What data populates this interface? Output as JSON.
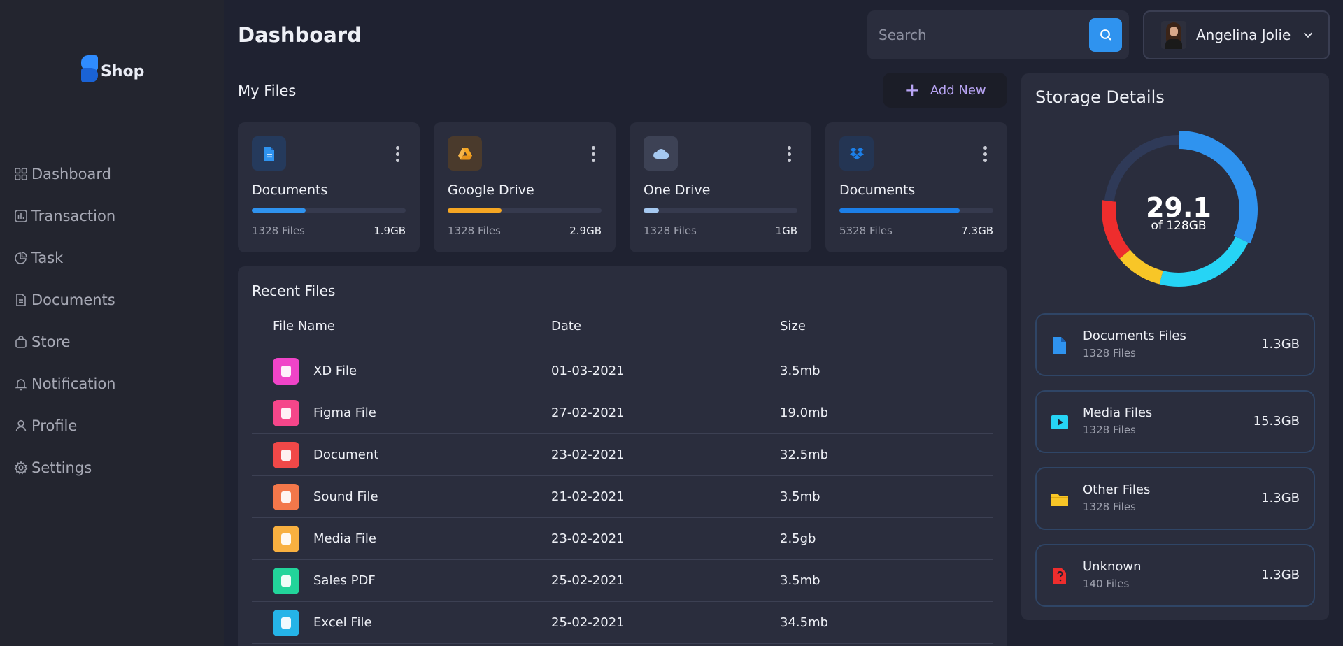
{
  "brand": {
    "name": "Shop"
  },
  "sidebar": {
    "items": [
      {
        "label": "Dashboard",
        "icon": "grid-icon"
      },
      {
        "label": "Transaction",
        "icon": "chart-icon"
      },
      {
        "label": "Task",
        "icon": "pie-icon"
      },
      {
        "label": "Documents",
        "icon": "document-icon"
      },
      {
        "label": "Store",
        "icon": "bag-icon"
      },
      {
        "label": "Notification",
        "icon": "bell-icon"
      },
      {
        "label": "Profile",
        "icon": "user-icon"
      },
      {
        "label": "Settings",
        "icon": "gear-icon"
      }
    ]
  },
  "header": {
    "title": "Dashboard",
    "search_placeholder": "Search",
    "user_name": "Angelina Jolie"
  },
  "my_files": {
    "title": "My Files",
    "add_label": "Add New",
    "cards": [
      {
        "title": "Documents",
        "files": "1328 Files",
        "size": "1.9GB",
        "progress": 0.35,
        "color": "#2f93ef",
        "icon_bg": "#253a5c",
        "icon": "document-icon"
      },
      {
        "title": "Google Drive",
        "files": "1328 Files",
        "size": "2.9GB",
        "progress": 0.35,
        "color": "#f5a623",
        "icon_bg": "#4a3a2c",
        "icon": "google-drive-icon"
      },
      {
        "title": "One Drive",
        "files": "1328 Files",
        "size": "1GB",
        "progress": 0.1,
        "color": "#a5c8f0",
        "icon_bg": "#3d4255",
        "icon": "cloud-icon"
      },
      {
        "title": "Documents",
        "files": "5328 Files",
        "size": "7.3GB",
        "progress": 0.78,
        "color": "#1c7fe8",
        "icon_bg": "#243553",
        "icon": "dropbox-icon"
      }
    ]
  },
  "recent": {
    "title": "Recent Files",
    "columns": [
      "File Name",
      "Date",
      "Size"
    ],
    "rows": [
      {
        "name": "XD File",
        "date": "01-03-2021",
        "size": "3.5mb",
        "color": "#f044c8"
      },
      {
        "name": "Figma File",
        "date": "27-02-2021",
        "size": "19.0mb",
        "color": "#f5468a"
      },
      {
        "name": "Document",
        "date": "23-02-2021",
        "size": "32.5mb",
        "color": "#f04848"
      },
      {
        "name": "Sound File",
        "date": "21-02-2021",
        "size": "3.5mb",
        "color": "#f3774a"
      },
      {
        "name": "Media File",
        "date": "23-02-2021",
        "size": "2.5gb",
        "color": "#f8b040"
      },
      {
        "name": "Sales PDF",
        "date": "25-02-2021",
        "size": "3.5mb",
        "color": "#22d49a"
      },
      {
        "name": "Excel File",
        "date": "25-02-2021",
        "size": "34.5mb",
        "color": "#25b4e8"
      }
    ]
  },
  "storage": {
    "title": "Storage Details",
    "used": "29.1",
    "total_label": "of 128GB",
    "segments": [
      {
        "value": 32,
        "color": "#2f93ef"
      },
      {
        "value": 22,
        "color": "#26d4f5"
      },
      {
        "value": 10,
        "color": "#f8c627"
      },
      {
        "value": 13,
        "color": "#ee2d2d"
      },
      {
        "value": 23,
        "color": "#2f3a58"
      }
    ],
    "items": [
      {
        "name": "Documents Files",
        "count": "1328 Files",
        "size": "1.3GB",
        "color": "#2f93ef",
        "icon": "document-icon"
      },
      {
        "name": "Media Files",
        "count": "1328 Files",
        "size": "15.3GB",
        "color": "#26d4f5",
        "icon": "media-icon"
      },
      {
        "name": "Other Files",
        "count": "1328 Files",
        "size": "1.3GB",
        "color": "#f8c627",
        "icon": "folder-icon"
      },
      {
        "name": "Unknown",
        "count": "140 Files",
        "size": "1.3GB",
        "color": "#ee2d2d",
        "icon": "unknown-file-icon"
      }
    ]
  }
}
